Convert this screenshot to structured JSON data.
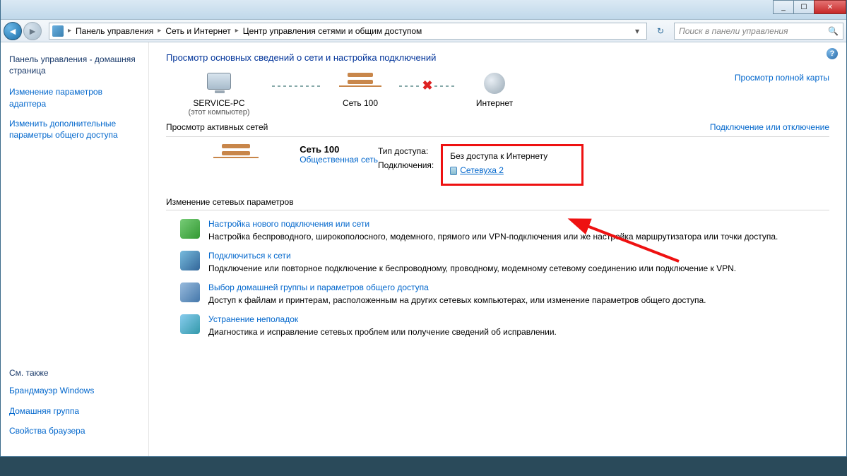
{
  "titlebar": {
    "min": "_",
    "max": "☐",
    "close": "✕"
  },
  "nav": {
    "crumbs": [
      "Панель управления",
      "Сеть и Интернет",
      "Центр управления сетями и общим доступом"
    ],
    "search_placeholder": "Поиск в панели управления"
  },
  "sidebar": {
    "home": "Панель управления - домашняя страница",
    "links": [
      "Изменение параметров адаптера",
      "Изменить дополнительные параметры общего доступа"
    ],
    "see_also_hdr": "См. также",
    "see_also": [
      "Брандмауэр Windows",
      "Домашняя группа",
      "Свойства браузера"
    ]
  },
  "content": {
    "title": "Просмотр основных сведений о сети и настройка подключений",
    "map": {
      "pc_name": "SERVICE-PC",
      "pc_sub": "(этот компьютер)",
      "net_name": "Сеть 100",
      "internet": "Интернет",
      "full_map": "Просмотр полной карты"
    },
    "active_hdr": "Просмотр активных сетей",
    "connect_link": "Подключение или отключение",
    "network": {
      "name": "Сеть 100",
      "type": "Общественная сеть",
      "access_lbl": "Тип доступа:",
      "access_val": "Без доступа к Интернету",
      "conn_lbl": "Подключения:",
      "conn_val": "Сетевуха 2"
    },
    "change_hdr": "Изменение сетевых параметров",
    "tasks": [
      {
        "link": "Настройка нового подключения или сети",
        "desc": "Настройка беспроводного, широкополосного, модемного, прямого или VPN-подключения или же настройка маршрутизатора или точки доступа."
      },
      {
        "link": "Подключиться к сети",
        "desc": "Подключение или повторное подключение к беспроводному, проводному, модемному сетевому соединению или подключение к VPN."
      },
      {
        "link": "Выбор домашней группы и параметров общего доступа",
        "desc": "Доступ к файлам и принтерам, расположенным на других сетевых компьютерах, или изменение параметров общего доступа."
      },
      {
        "link": "Устранение неполадок",
        "desc": "Диагностика и исправление сетевых проблем или получение сведений об исправлении."
      }
    ]
  }
}
